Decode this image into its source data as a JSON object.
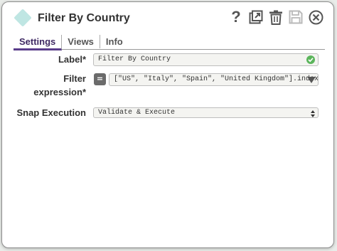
{
  "dialog": {
    "title": "Filter By Country",
    "icon": "snap-diamond-icon",
    "actions": [
      "help-icon",
      "export-icon",
      "delete-icon",
      "save-icon",
      "close-icon"
    ]
  },
  "tabs": [
    {
      "label": "Settings",
      "active": true
    },
    {
      "label": "Views",
      "active": false
    },
    {
      "label": "Info",
      "active": false
    }
  ],
  "form": {
    "label": {
      "caption": "Label*",
      "value": "Filter By Country"
    },
    "filter": {
      "caption_line1": "Filter",
      "caption_line2": "expression*",
      "toggle": "=",
      "value": "[\"US\", \"Italy\", \"Spain\", \"United Kingdom\"].index"
    },
    "snap_execution": {
      "caption": "Snap Execution",
      "value": "Validate & Execute"
    }
  },
  "colors": {
    "accent": "#5a3d8a",
    "snap_icon": "#bfe6e3",
    "valid": "#5bb55b"
  }
}
